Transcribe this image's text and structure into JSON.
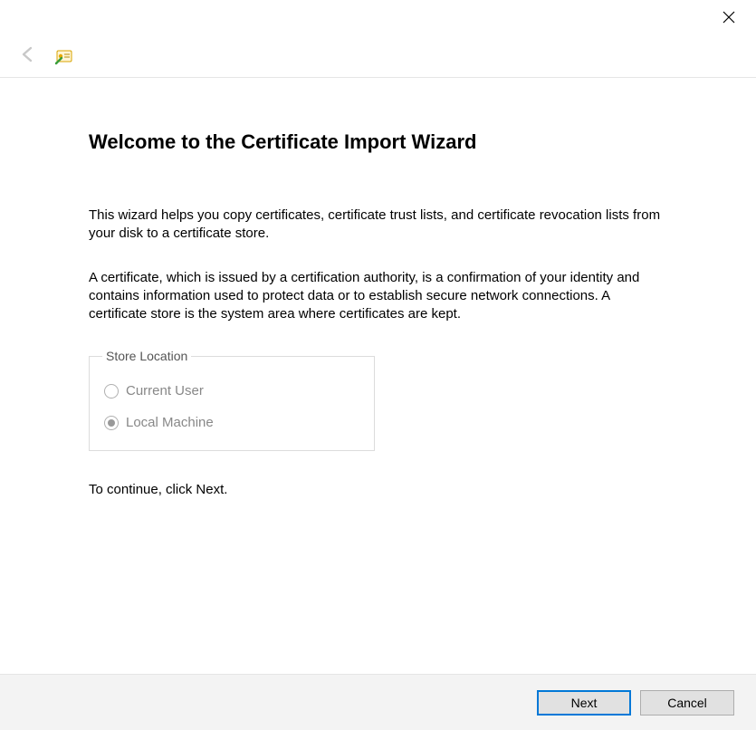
{
  "header": {
    "title": "Welcome to the Certificate Import Wizard"
  },
  "body": {
    "intro": "This wizard helps you copy certificates, certificate trust lists, and certificate revocation lists from your disk to a certificate store.",
    "explain": "A certificate, which is issued by a certification authority, is a confirmation of your identity and contains information used to protect data or to establish secure network connections. A certificate store is the system area where certificates are kept.",
    "continue": "To continue, click Next."
  },
  "storeLocation": {
    "legend": "Store Location",
    "options": [
      {
        "label": "Current User",
        "selected": false
      },
      {
        "label": "Local Machine",
        "selected": true
      }
    ]
  },
  "footer": {
    "next": "Next",
    "cancel": "Cancel"
  }
}
